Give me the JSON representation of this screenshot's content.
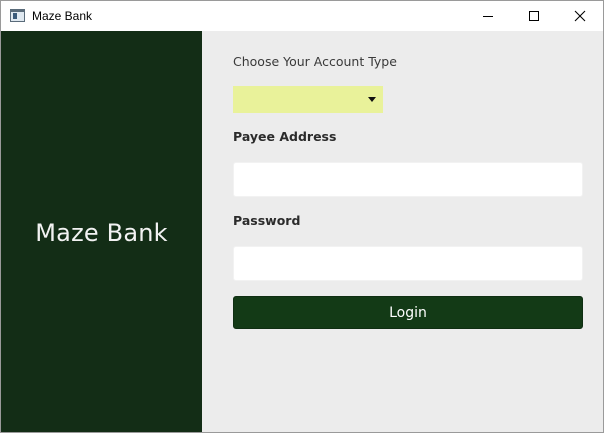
{
  "window": {
    "title": "Maze Bank",
    "controls": {
      "minimize": "minimize",
      "maximize": "maximize",
      "close": "close"
    }
  },
  "sidebar": {
    "brand": "Maze Bank",
    "background": "#132d16"
  },
  "form": {
    "account_type_label": "Choose Your Account Type",
    "account_type_value": "",
    "payee_label": "Payee Address",
    "payee_value": "",
    "password_label": "Password",
    "password_value": "",
    "login_label": "Login"
  },
  "colors": {
    "accent": "#133a16",
    "combo": "#e9f29a",
    "panel": "#ececec"
  }
}
